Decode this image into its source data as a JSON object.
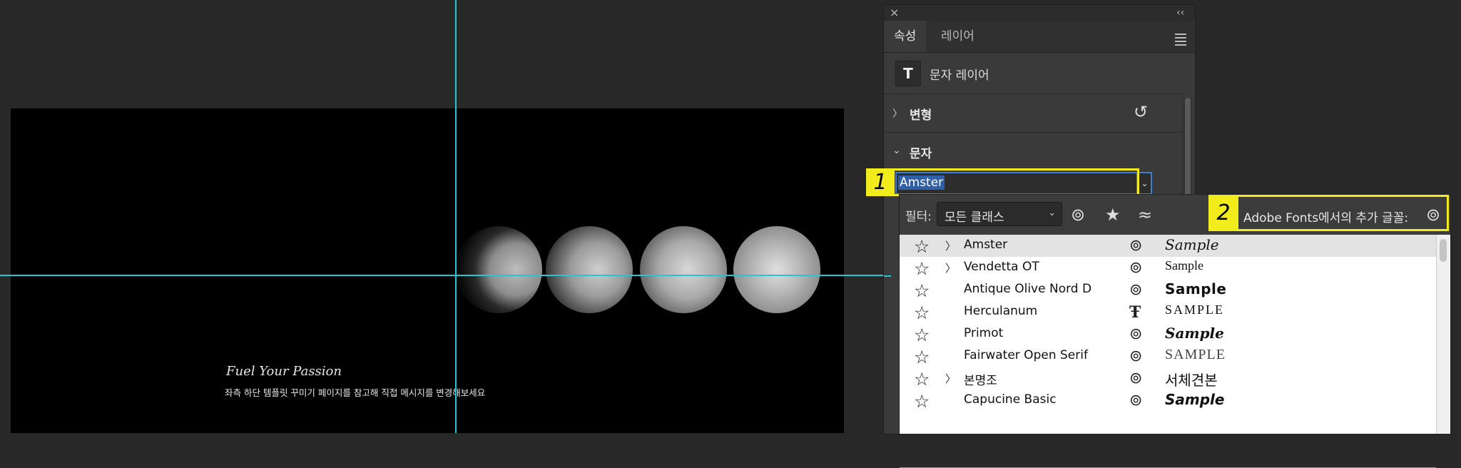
{
  "canvas": {
    "title_text": "Fuel Your Passion",
    "subtitle_text": "좌측 하단 템플릿 꾸미기 페이지를 참고해 직접 메시지를 변경해보세요"
  },
  "panel": {
    "close_glyph": "×",
    "collapse_glyph": "‹‹",
    "tabs": [
      {
        "label": "속성",
        "active": true
      },
      {
        "label": "레이어",
        "active": false
      }
    ],
    "layer_type_glyph": "T",
    "layer_type_label": "문자 레이어",
    "sections": {
      "transform": "변형",
      "character": "문자"
    },
    "reset_icon": "undo-icon",
    "font_value": "Amster",
    "font_dropdown_glyph": "⌄"
  },
  "badges": {
    "one": "1",
    "two": "2"
  },
  "font_menu": {
    "filter_label": "필터:",
    "filter_value": "모든 클래스",
    "filter_icons": [
      "creative-cloud-icon",
      "star-icon",
      "similar-icon"
    ],
    "adobe_fonts_label": "Adobe Fonts에서의 추가 글꼴:",
    "fonts": [
      {
        "name": "Amster",
        "has_children": true,
        "source": "creative-cloud",
        "sample": "Sample",
        "selected": true
      },
      {
        "name": "Vendetta OT",
        "has_children": true,
        "source": "creative-cloud",
        "sample": "Sample",
        "selected": false
      },
      {
        "name": "Antique Olive Nord D",
        "has_children": false,
        "source": "creative-cloud",
        "sample": "Sample",
        "selected": false
      },
      {
        "name": "Herculanum",
        "has_children": false,
        "source": "truetype",
        "sample": "SAMPLE",
        "selected": false
      },
      {
        "name": "Primot",
        "has_children": false,
        "source": "creative-cloud",
        "sample": "Sample",
        "selected": false
      },
      {
        "name": "Fairwater Open Serif",
        "has_children": false,
        "source": "creative-cloud",
        "sample": "SAMPLE",
        "selected": false
      },
      {
        "name": "본명조",
        "has_children": true,
        "source": "creative-cloud",
        "sample": "서체견본",
        "selected": false
      },
      {
        "name": "Capucine Basic",
        "has_children": false,
        "source": "creative-cloud",
        "sample": "Sample",
        "selected": false
      }
    ]
  },
  "colors": {
    "guide": "#23c6d6",
    "highlight": "#f2ec1d",
    "selection": "#2f5fa8"
  }
}
